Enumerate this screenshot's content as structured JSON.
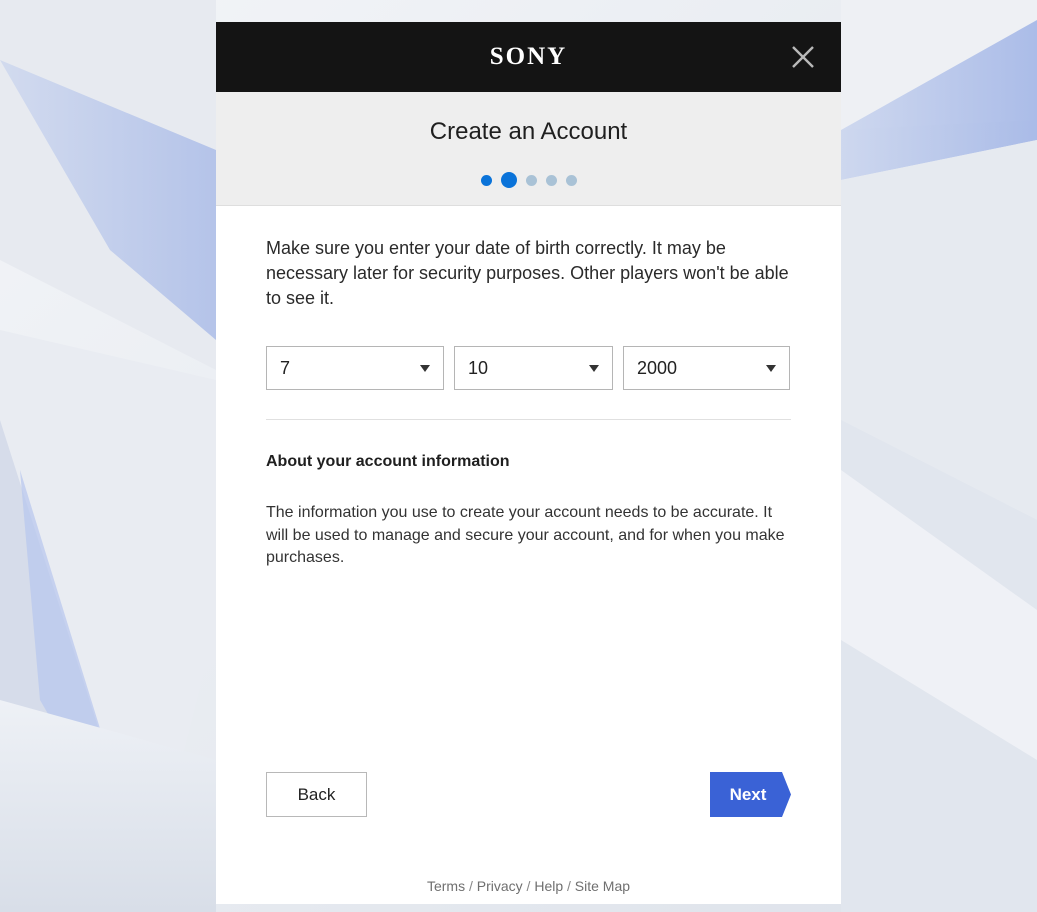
{
  "brand": {
    "logo_text": "SONY"
  },
  "header": {
    "title": "Create an Account"
  },
  "stepper": {
    "total_steps": 5,
    "current_step": 2
  },
  "intro": {
    "text": "Make sure you enter your date of birth correctly. It may be necessary later for security purposes. Other players won't be able to see it."
  },
  "date_of_birth": {
    "first": "7",
    "second": "10",
    "year": "2000"
  },
  "account_info": {
    "heading": "About your account information",
    "body": "The information you use to create your account needs to be accurate. It will be used to manage and secure your account, and for when you make purchases."
  },
  "actions": {
    "back_label": "Back",
    "next_label": "Next"
  },
  "footer": {
    "links": [
      "Terms",
      "Privacy",
      "Help",
      "Site Map"
    ],
    "separator": "/"
  },
  "colors": {
    "topbar": "#141414",
    "accent_blue": "#0a73d9",
    "next_button": "#3a62d6",
    "inactive_dot": "#a9c2d6"
  },
  "icons": {
    "close": "close-icon",
    "dropdown": "caret-down-icon"
  }
}
